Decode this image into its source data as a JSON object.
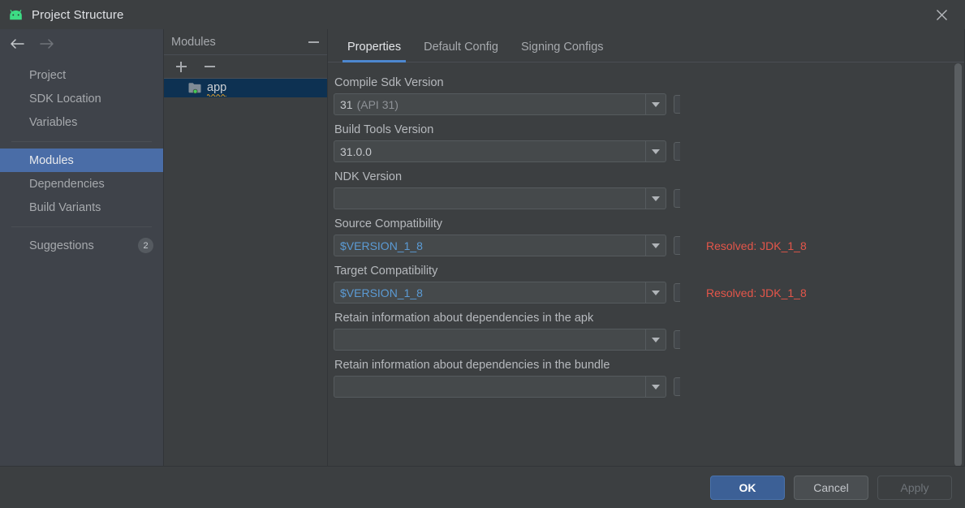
{
  "window": {
    "title": "Project Structure",
    "logo_icon": "android-logo-icon",
    "close_icon": "close-icon"
  },
  "sidebar": {
    "back_icon": "arrow-left-icon",
    "forward_icon": "arrow-right-icon",
    "items": [
      {
        "label": "Project",
        "selected": false
      },
      {
        "label": "SDK Location",
        "selected": false
      },
      {
        "label": "Variables",
        "selected": false
      },
      {
        "label": "Modules",
        "selected": true
      },
      {
        "label": "Dependencies",
        "selected": false
      },
      {
        "label": "Build Variants",
        "selected": false
      }
    ],
    "suggestions": {
      "label": "Suggestions",
      "badge": "2"
    }
  },
  "modules_panel": {
    "title": "Modules",
    "minimize_icon": "minimize-icon",
    "add_icon": "plus-icon",
    "remove_icon": "minus-icon",
    "modules": [
      {
        "name": "app",
        "icon": "module-folder-icon",
        "selected": true,
        "has_warning": true
      }
    ]
  },
  "main": {
    "tabs": [
      {
        "label": "Properties",
        "active": true
      },
      {
        "label": "Default Config",
        "active": false
      },
      {
        "label": "Signing Configs",
        "active": false
      }
    ],
    "fields": [
      {
        "label": "Compile Sdk Version",
        "value": "31",
        "value_suffix": "(API 31)",
        "value_style": "plain",
        "resolved": ""
      },
      {
        "label": "Build Tools Version",
        "value": "31.0.0",
        "value_suffix": "",
        "value_style": "plain",
        "resolved": ""
      },
      {
        "label": "NDK Version",
        "value": "",
        "value_suffix": "",
        "value_style": "plain",
        "resolved": ""
      },
      {
        "label": "Source Compatibility",
        "value": "$VERSION_1_8",
        "value_suffix": "",
        "value_style": "variable",
        "resolved": "Resolved: JDK_1_8"
      },
      {
        "label": "Target Compatibility",
        "value": "$VERSION_1_8",
        "value_suffix": "",
        "value_style": "variable",
        "resolved": "Resolved: JDK_1_8"
      },
      {
        "label": "Retain information about dependencies in the apk",
        "value": "",
        "value_suffix": "",
        "value_style": "plain",
        "resolved": ""
      },
      {
        "label": "Retain information about dependencies in the bundle",
        "value": "",
        "value_suffix": "",
        "value_style": "plain",
        "resolved": ""
      }
    ]
  },
  "footer": {
    "ok_label": "OK",
    "cancel_label": "Cancel",
    "apply_label": "Apply"
  },
  "colors": {
    "accent_blue": "#4a6da7",
    "tab_underline": "#4d87d0",
    "variable_blue": "#5b9bd5",
    "resolved_red": "#e4564a",
    "selection_navy": "#0d3152",
    "primary_button": "#3c6096",
    "android_green": "#3ddc84"
  }
}
